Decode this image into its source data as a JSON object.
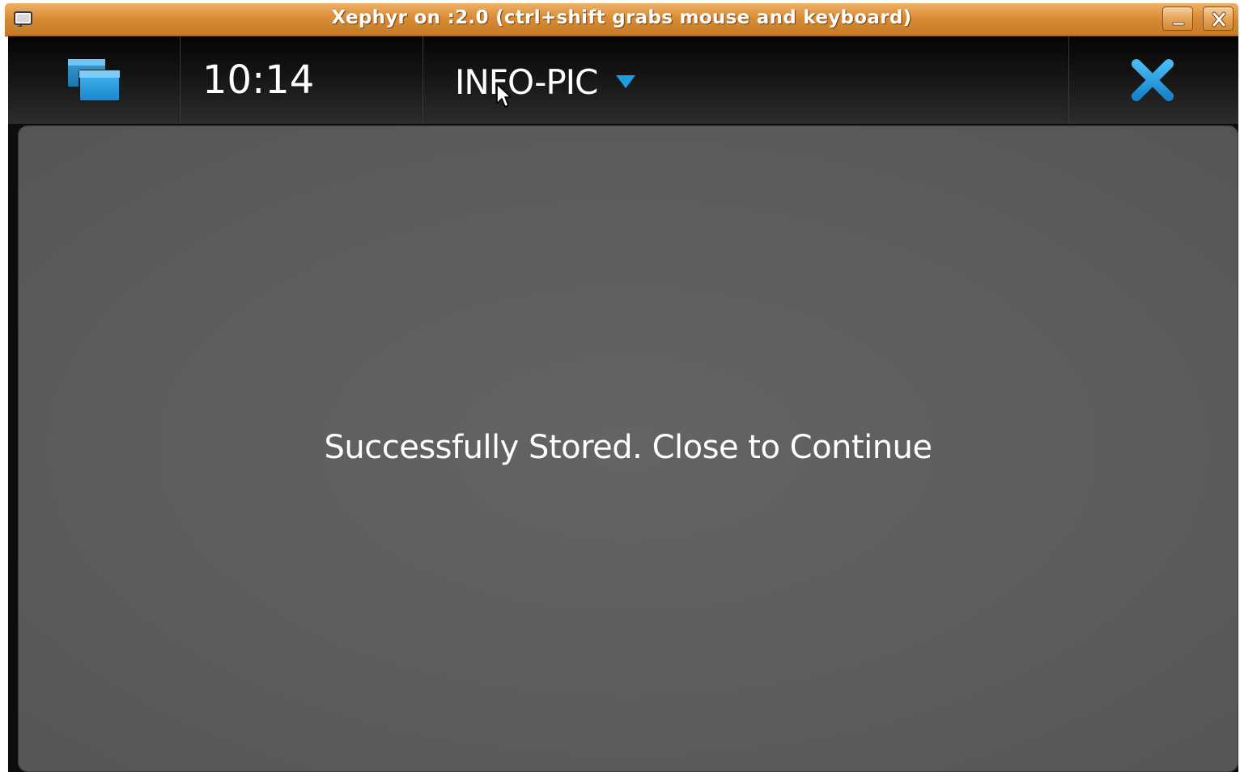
{
  "window": {
    "title": "Xephyr on :2.0 (ctrl+shift grabs mouse and keyboard)",
    "icon": "terminal-window-icon",
    "buttons": {
      "minimize_icon": "minimize-icon",
      "close_icon": "close-icon"
    }
  },
  "topbar": {
    "switcher_icon": "task-switcher-icon",
    "clock": "10:14",
    "menu_title": "INFO-PIC",
    "menu_arrow_icon": "dropdown-arrow-icon",
    "close_icon": "close-x-icon",
    "accent_color": "#1f9be0"
  },
  "content": {
    "message": "Successfully Stored. Close to Continue"
  },
  "colors": {
    "titlebar": "#d98c36",
    "topbar": "#151515",
    "content_bg": "#5e5e5e",
    "text": "#ffffff",
    "accent": "#1f9be0"
  }
}
